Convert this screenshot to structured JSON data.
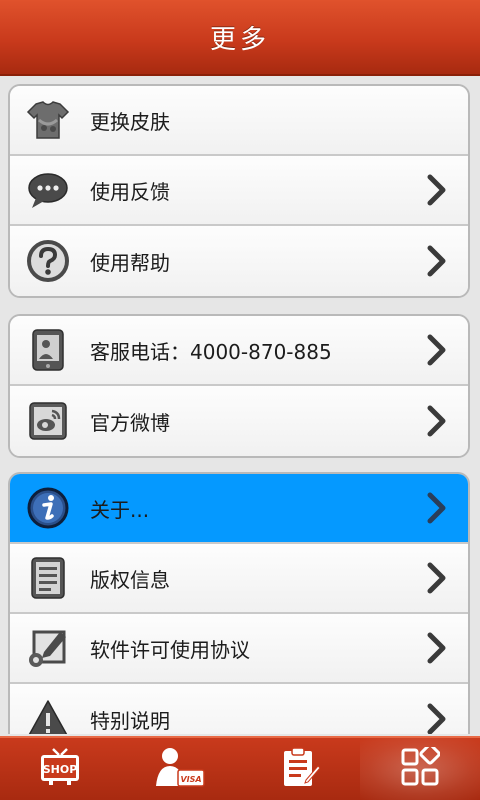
{
  "header": {
    "title": "更多"
  },
  "groups": [
    {
      "rows": [
        {
          "label": "更换皮肤",
          "icon": "tshirt-skin-icon",
          "chevron": false
        },
        {
          "label": "使用反馈",
          "icon": "chat-bubble-icon",
          "chevron": true
        },
        {
          "label": "使用帮助",
          "icon": "help-question-icon",
          "chevron": true
        }
      ]
    },
    {
      "rows": [
        {
          "label": "客服电话：4000-870-885",
          "icon": "phone-contact-icon",
          "chevron": true
        },
        {
          "label": "官方微博",
          "icon": "weibo-icon",
          "chevron": true
        }
      ]
    },
    {
      "rows": [
        {
          "label": "关于...",
          "icon": "info-icon",
          "chevron": true,
          "selected": true
        },
        {
          "label": "版权信息",
          "icon": "document-icon",
          "chevron": true
        },
        {
          "label": "软件许可使用协议",
          "icon": "edit-settings-icon",
          "chevron": true
        },
        {
          "label": "特别说明",
          "icon": "warning-icon",
          "chevron": true
        }
      ]
    }
  ],
  "tabbar": {
    "tabs": [
      {
        "icon": "shop-tv-icon",
        "text": "SHOP"
      },
      {
        "icon": "user-card-icon",
        "text": "VISA"
      },
      {
        "icon": "clipboard-icon"
      },
      {
        "icon": "more-grid-icon",
        "active": true
      }
    ]
  },
  "colors": {
    "header": "#c93a1c",
    "selected_row": "#0599ff",
    "background": "#e6e6e6"
  }
}
